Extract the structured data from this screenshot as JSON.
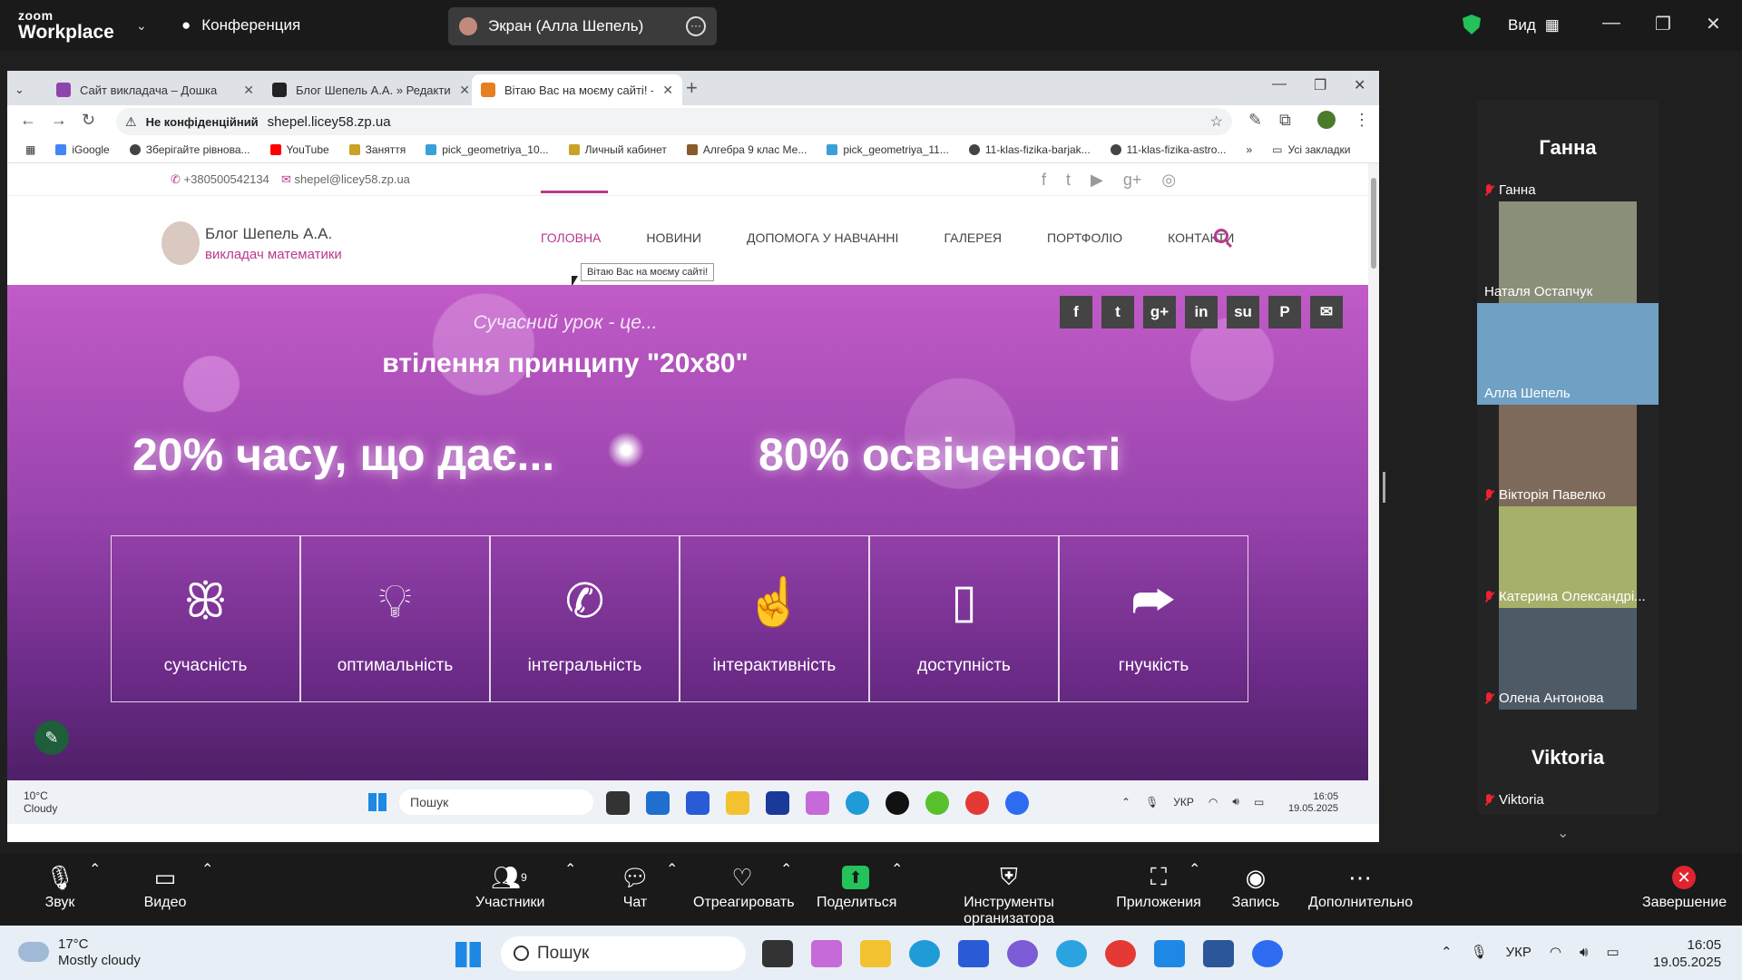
{
  "zoom": {
    "logo_top": "zoom",
    "logo_bottom": "Workplace",
    "conference": "Конференция",
    "screen_share": "Экран (Алла Шепель)",
    "view": "Вид"
  },
  "browser": {
    "tabs": [
      {
        "title": "Сайт викладача – Дошка",
        "color": "#8e44ad"
      },
      {
        "title": "Блог Шепель А.А. » Редактиро",
        "color": "#222222"
      },
      {
        "title": "Вітаю Вас на моєму сайті! - Бл",
        "color": "#e67e22"
      }
    ],
    "not_private": "Не конфіденційний",
    "url": "shepel.licey58.zp.ua",
    "bookmarks": [
      "iGoogle",
      "Зберігайте рівнова...",
      "YouTube",
      "Заняття",
      "pick_geometriya_10...",
      "Личный кабинет",
      "Алгебра 9 клас Ме...",
      "pick_geometriya_11...",
      "11-klas-fizika-barjak...",
      "11-klas-fizika-astro..."
    ],
    "all_bookmarks": "Усі закладки"
  },
  "site": {
    "phone": "+380500542134",
    "email": "shepel@licey58.zp.ua",
    "brand_name": "Блог Шепель А.А.",
    "brand_sub": "викладач математики",
    "menu": [
      "ГОЛОВНА",
      "НОВИНИ",
      "ДОПОМОГА У НАВЧАННІ",
      "ГАЛЕРЕЯ",
      "ПОРТФОЛІО",
      "КОНТАКТИ"
    ],
    "tooltip": "Вітаю Вас на моєму сайті!",
    "hero_small": "Сучасний урок - це...",
    "hero_mid": "втілення принципу \"20х80\"",
    "hero_left": "20% часу, що дає...",
    "hero_right": "80% освіченості",
    "features": [
      "сучасність",
      "оптимальність",
      "інтегральність",
      "інтерактивність",
      "доступність",
      "гнучкість"
    ],
    "accent": "#b83a8c"
  },
  "inner_taskbar": {
    "temp": "10°C",
    "weather": "Cloudy",
    "search": "Пошук",
    "lang": "УКР",
    "time": "16:05",
    "date": "19.05.2025"
  },
  "participants": [
    {
      "name": "Ганна",
      "big": "Ганна",
      "type": "avatar"
    },
    {
      "name": "Наталя Остапчук",
      "type": "video",
      "color": "#8a8f7a"
    },
    {
      "name": "Алла Шепель",
      "type": "video",
      "color": "#6fa1c4",
      "active": true
    },
    {
      "name": "Вікторія Павелко",
      "type": "video",
      "color": "#7d6a5a"
    },
    {
      "name": "Катерина Олександрі...",
      "type": "video",
      "color": "#a7b06a"
    },
    {
      "name": "Олена Антонова",
      "type": "video",
      "color": "#4e5a66"
    },
    {
      "name": "Viktoria",
      "big": "Viktoria",
      "type": "avatar"
    }
  ],
  "controls": {
    "audio": "Звук",
    "video": "Видео",
    "participants": "Участники",
    "participants_count": "9",
    "chat": "Чат",
    "react": "Отреагировать",
    "share": "Поделиться",
    "host_tools": "Инструменты организатора",
    "apps": "Приложения",
    "record": "Запись",
    "more": "Дополнительно",
    "end": "Завершение"
  },
  "host_taskbar": {
    "temp": "17°C",
    "weather": "Mostly cloudy",
    "search": "Пошук",
    "lang": "УКР",
    "time": "16:05",
    "date": "19.05.2025"
  }
}
